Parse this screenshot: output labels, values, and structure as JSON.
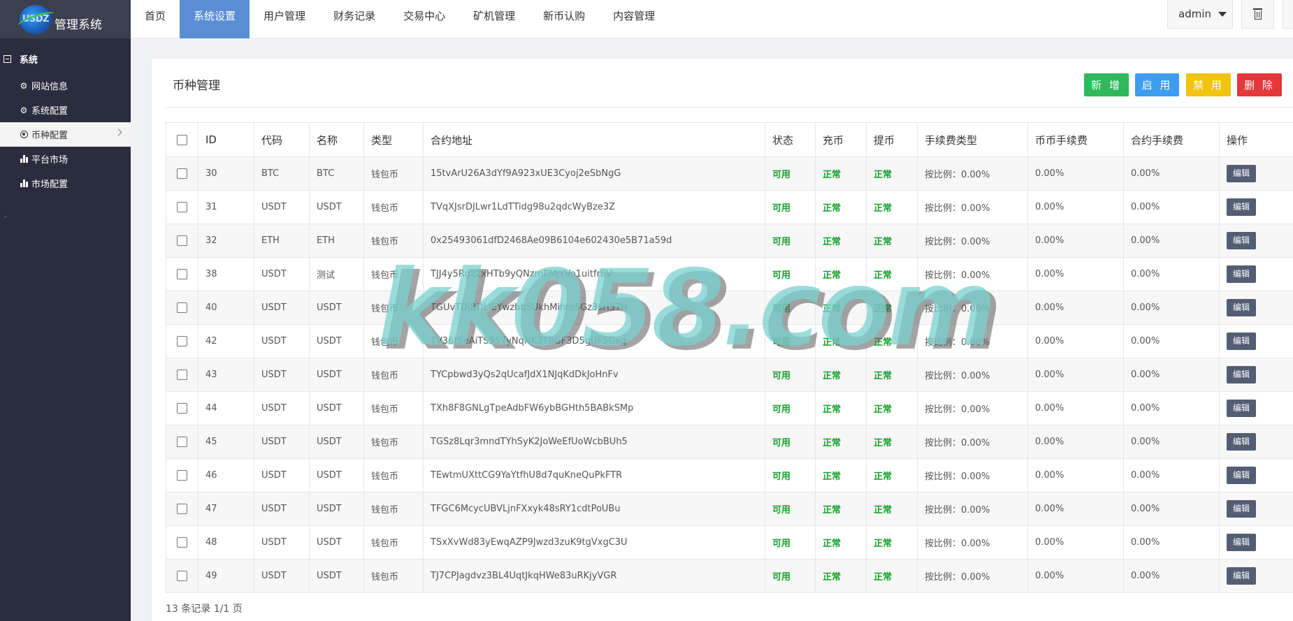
{
  "sidebar": {
    "logo_text": "USDZ",
    "title": "管理系统",
    "group": "系统",
    "items": [
      {
        "label": "网站信息",
        "icon": "gear-icon"
      },
      {
        "label": "系统配置",
        "icon": "gear-icon"
      },
      {
        "label": "币种配置",
        "icon": "circle-dot-icon",
        "active": true
      },
      {
        "label": "平台市场",
        "icon": "bar-chart-icon"
      },
      {
        "label": "市场配置",
        "icon": "bar-chart-icon"
      }
    ]
  },
  "topnav": {
    "items": [
      "首页",
      "系统设置",
      "用户管理",
      "财务记录",
      "交易中心",
      "矿机管理",
      "新币认购",
      "内容管理"
    ],
    "active_index": 1,
    "user": "admin"
  },
  "panel": {
    "title": "币种管理",
    "buttons": {
      "add": "新 增",
      "enable": "启 用",
      "disable": "禁 用",
      "delete": "删 除"
    },
    "colors": {
      "add": "#2fb85c",
      "enable": "#3d9ef0",
      "disable": "#f1c40f",
      "delete": "#e5383b",
      "active_nav": "#5a8fd6",
      "status_green": "#17a02c"
    }
  },
  "table": {
    "headers": [
      "ID",
      "代码",
      "名称",
      "类型",
      "合约地址",
      "状态",
      "充币",
      "提币",
      "手续费类型",
      "币币手续费",
      "合约手续费",
      "操作"
    ],
    "rows": [
      {
        "id": "30",
        "code": "BTC",
        "name": "BTC",
        "type": "钱包币",
        "address": "15tvArU26A3dYf9A923xUE3Cyoj2eSbNgG",
        "status": "可用",
        "deposit": "正常",
        "withdraw": "正常",
        "fee_type": "按比例：0.00%",
        "spot_fee": "0.00%",
        "contract_fee": "0.00%",
        "action": "编辑"
      },
      {
        "id": "31",
        "code": "USDT",
        "name": "USDT",
        "type": "钱包币",
        "address": "TVqXJsrDJLwr1LdTTidg98u2qdcWyBze3Z",
        "status": "可用",
        "deposit": "正常",
        "withdraw": "正常",
        "fee_type": "按比例：0.00%",
        "spot_fee": "0.00%",
        "contract_fee": "0.00%",
        "action": "编辑"
      },
      {
        "id": "32",
        "code": "ETH",
        "name": "ETH",
        "type": "钱包币",
        "address": "0x25493061dfD2468Ae09B6104e602430e5B71a59d",
        "status": "可用",
        "deposit": "正常",
        "withdraw": "正常",
        "fee_type": "按比例：0.00%",
        "spot_fee": "0.00%",
        "contract_fee": "0.00%",
        "action": "编辑"
      },
      {
        "id": "38",
        "code": "USDT",
        "name": "测试",
        "type": "钱包币",
        "address": "TJJ4y5Rgz2xHTb9yQNzmPMjYVo1uitfrBV",
        "status": "可用",
        "deposit": "正常",
        "withdraw": "正常",
        "fee_type": "按比例：0.00%",
        "spot_fee": "0.00%",
        "contract_fee": "0.00%",
        "action": "编辑"
      },
      {
        "id": "40",
        "code": "USDT",
        "name": "USDT",
        "type": "钱包币",
        "address": "TGUvTDiBDLiEYwzbbSUkhMihm5Gz3sH37H",
        "status": "可用",
        "deposit": "正常",
        "withdraw": "正常",
        "fee_type": "按比例：0.00%",
        "spot_fee": "0.00%",
        "contract_fee": "0.00%",
        "action": "编辑"
      },
      {
        "id": "42",
        "code": "USDT",
        "name": "USDT",
        "type": "钱包币",
        "address": "TV36tSeAiTS957yNqNK3T8GF3D5gUF5Gxq",
        "status": "可用",
        "deposit": "正常",
        "withdraw": "正常",
        "fee_type": "按比例：0.00%",
        "spot_fee": "0.00%",
        "contract_fee": "0.00%",
        "action": "编辑"
      },
      {
        "id": "43",
        "code": "USDT",
        "name": "USDT",
        "type": "钱包币",
        "address": "TYCpbwd3yQs2qUcafJdX1NJqKdDkJoHnFv",
        "status": "可用",
        "deposit": "正常",
        "withdraw": "正常",
        "fee_type": "按比例：0.00%",
        "spot_fee": "0.00%",
        "contract_fee": "0.00%",
        "action": "编辑"
      },
      {
        "id": "44",
        "code": "USDT",
        "name": "USDT",
        "type": "钱包币",
        "address": "TXh8F8GNLgTpeAdbFW6ybBGHth5BABkSMp",
        "status": "可用",
        "deposit": "正常",
        "withdraw": "正常",
        "fee_type": "按比例：0.00%",
        "spot_fee": "0.00%",
        "contract_fee": "0.00%",
        "action": "编辑"
      },
      {
        "id": "45",
        "code": "USDT",
        "name": "USDT",
        "type": "钱包币",
        "address": "TGSz8Lqr3mndTYhSyK2JoWeEfUoWcbBUh5",
        "status": "可用",
        "deposit": "正常",
        "withdraw": "正常",
        "fee_type": "按比例：0.00%",
        "spot_fee": "0.00%",
        "contract_fee": "0.00%",
        "action": "编辑"
      },
      {
        "id": "46",
        "code": "USDT",
        "name": "USDT",
        "type": "钱包币",
        "address": "TEwtmUXttCG9YaYtfhU8d7quKneQuPkFTR",
        "status": "可用",
        "deposit": "正常",
        "withdraw": "正常",
        "fee_type": "按比例：0.00%",
        "spot_fee": "0.00%",
        "contract_fee": "0.00%",
        "action": "编辑"
      },
      {
        "id": "47",
        "code": "USDT",
        "name": "USDT",
        "type": "钱包币",
        "address": "TFGC6McycUBVLjnFXxyk48sRY1cdtPoUBu",
        "status": "可用",
        "deposit": "正常",
        "withdraw": "正常",
        "fee_type": "按比例：0.00%",
        "spot_fee": "0.00%",
        "contract_fee": "0.00%",
        "action": "编辑"
      },
      {
        "id": "48",
        "code": "USDT",
        "name": "USDT",
        "type": "钱包币",
        "address": "TSxXvWd83yEwqAZP9Jwzd3zuK9tgVxgC3U",
        "status": "可用",
        "deposit": "正常",
        "withdraw": "正常",
        "fee_type": "按比例：0.00%",
        "spot_fee": "0.00%",
        "contract_fee": "0.00%",
        "action": "编辑"
      },
      {
        "id": "49",
        "code": "USDT",
        "name": "USDT",
        "type": "钱包币",
        "address": "TJ7CPJagdvz3BL4UqtJkqHWe83uRKjyVGR",
        "status": "可用",
        "deposit": "正常",
        "withdraw": "正常",
        "fee_type": "按比例：0.00%",
        "spot_fee": "0.00%",
        "contract_fee": "0.00%",
        "action": "编辑"
      }
    ]
  },
  "footer": "13 条记录 1/1 页",
  "watermark": "kk058.com"
}
